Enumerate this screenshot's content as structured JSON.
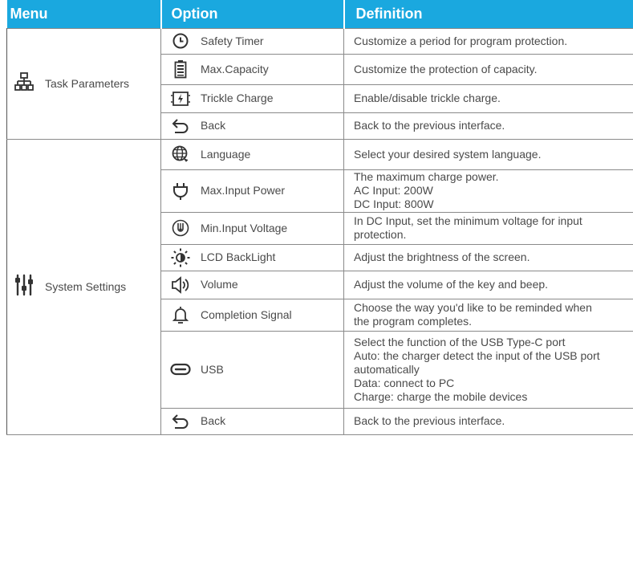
{
  "headers": {
    "menu": "Menu",
    "option": "Option",
    "definition": "Definition"
  },
  "groups": [
    {
      "menu_label": "Task Parameters",
      "menu_icon": "sitemap-icon",
      "rows": [
        {
          "icon": "clock-icon",
          "option": "Safety Timer",
          "definition": [
            "Customize a period for program protection."
          ]
        },
        {
          "icon": "battery-icon",
          "option": "Max.Capacity",
          "definition": [
            "Customize the protection of capacity."
          ]
        },
        {
          "icon": "charge-icon",
          "option": "Trickle Charge",
          "definition": [
            "Enable/disable trickle charge."
          ]
        },
        {
          "icon": "back-arrow-icon",
          "option": "Back",
          "definition": [
            "Back to the previous interface."
          ]
        }
      ]
    },
    {
      "menu_label": "System Settings",
      "menu_icon": "sliders-icon",
      "rows": [
        {
          "icon": "globe-icon",
          "option": "Language",
          "definition": [
            "Select your desired system language."
          ]
        },
        {
          "icon": "plug-icon",
          "option": "Max.Input Power",
          "definition": [
            "The maximum charge power.",
            "AC Input: 200W",
            "DC Input: 800W"
          ]
        },
        {
          "icon": "voltage-icon",
          "option": "Min.Input Voltage",
          "definition": [
            "In DC Input, set the minimum voltage for input",
            "protection."
          ]
        },
        {
          "icon": "brightness-icon",
          "option": "LCD BackLight",
          "definition": [
            "Adjust the brightness of the screen."
          ]
        },
        {
          "icon": "speaker-icon",
          "option": "Volume",
          "definition": [
            "Adjust the volume of the key and beep."
          ]
        },
        {
          "icon": "bell-icon",
          "option": "Completion Signal",
          "definition": [
            "Choose the way you'd like to be reminded when",
            "the program completes."
          ]
        },
        {
          "icon": "usb-c-icon",
          "option": "USB",
          "definition": [
            "Select the function of the USB Type-C port",
            "Auto: the charger detect the input of the USB port",
            "automatically",
            "Data: connect to PC",
            "Charge: charge the mobile devices"
          ]
        },
        {
          "icon": "back-arrow-icon",
          "option": "Back",
          "definition": [
            "Back to the previous interface."
          ]
        }
      ]
    }
  ]
}
